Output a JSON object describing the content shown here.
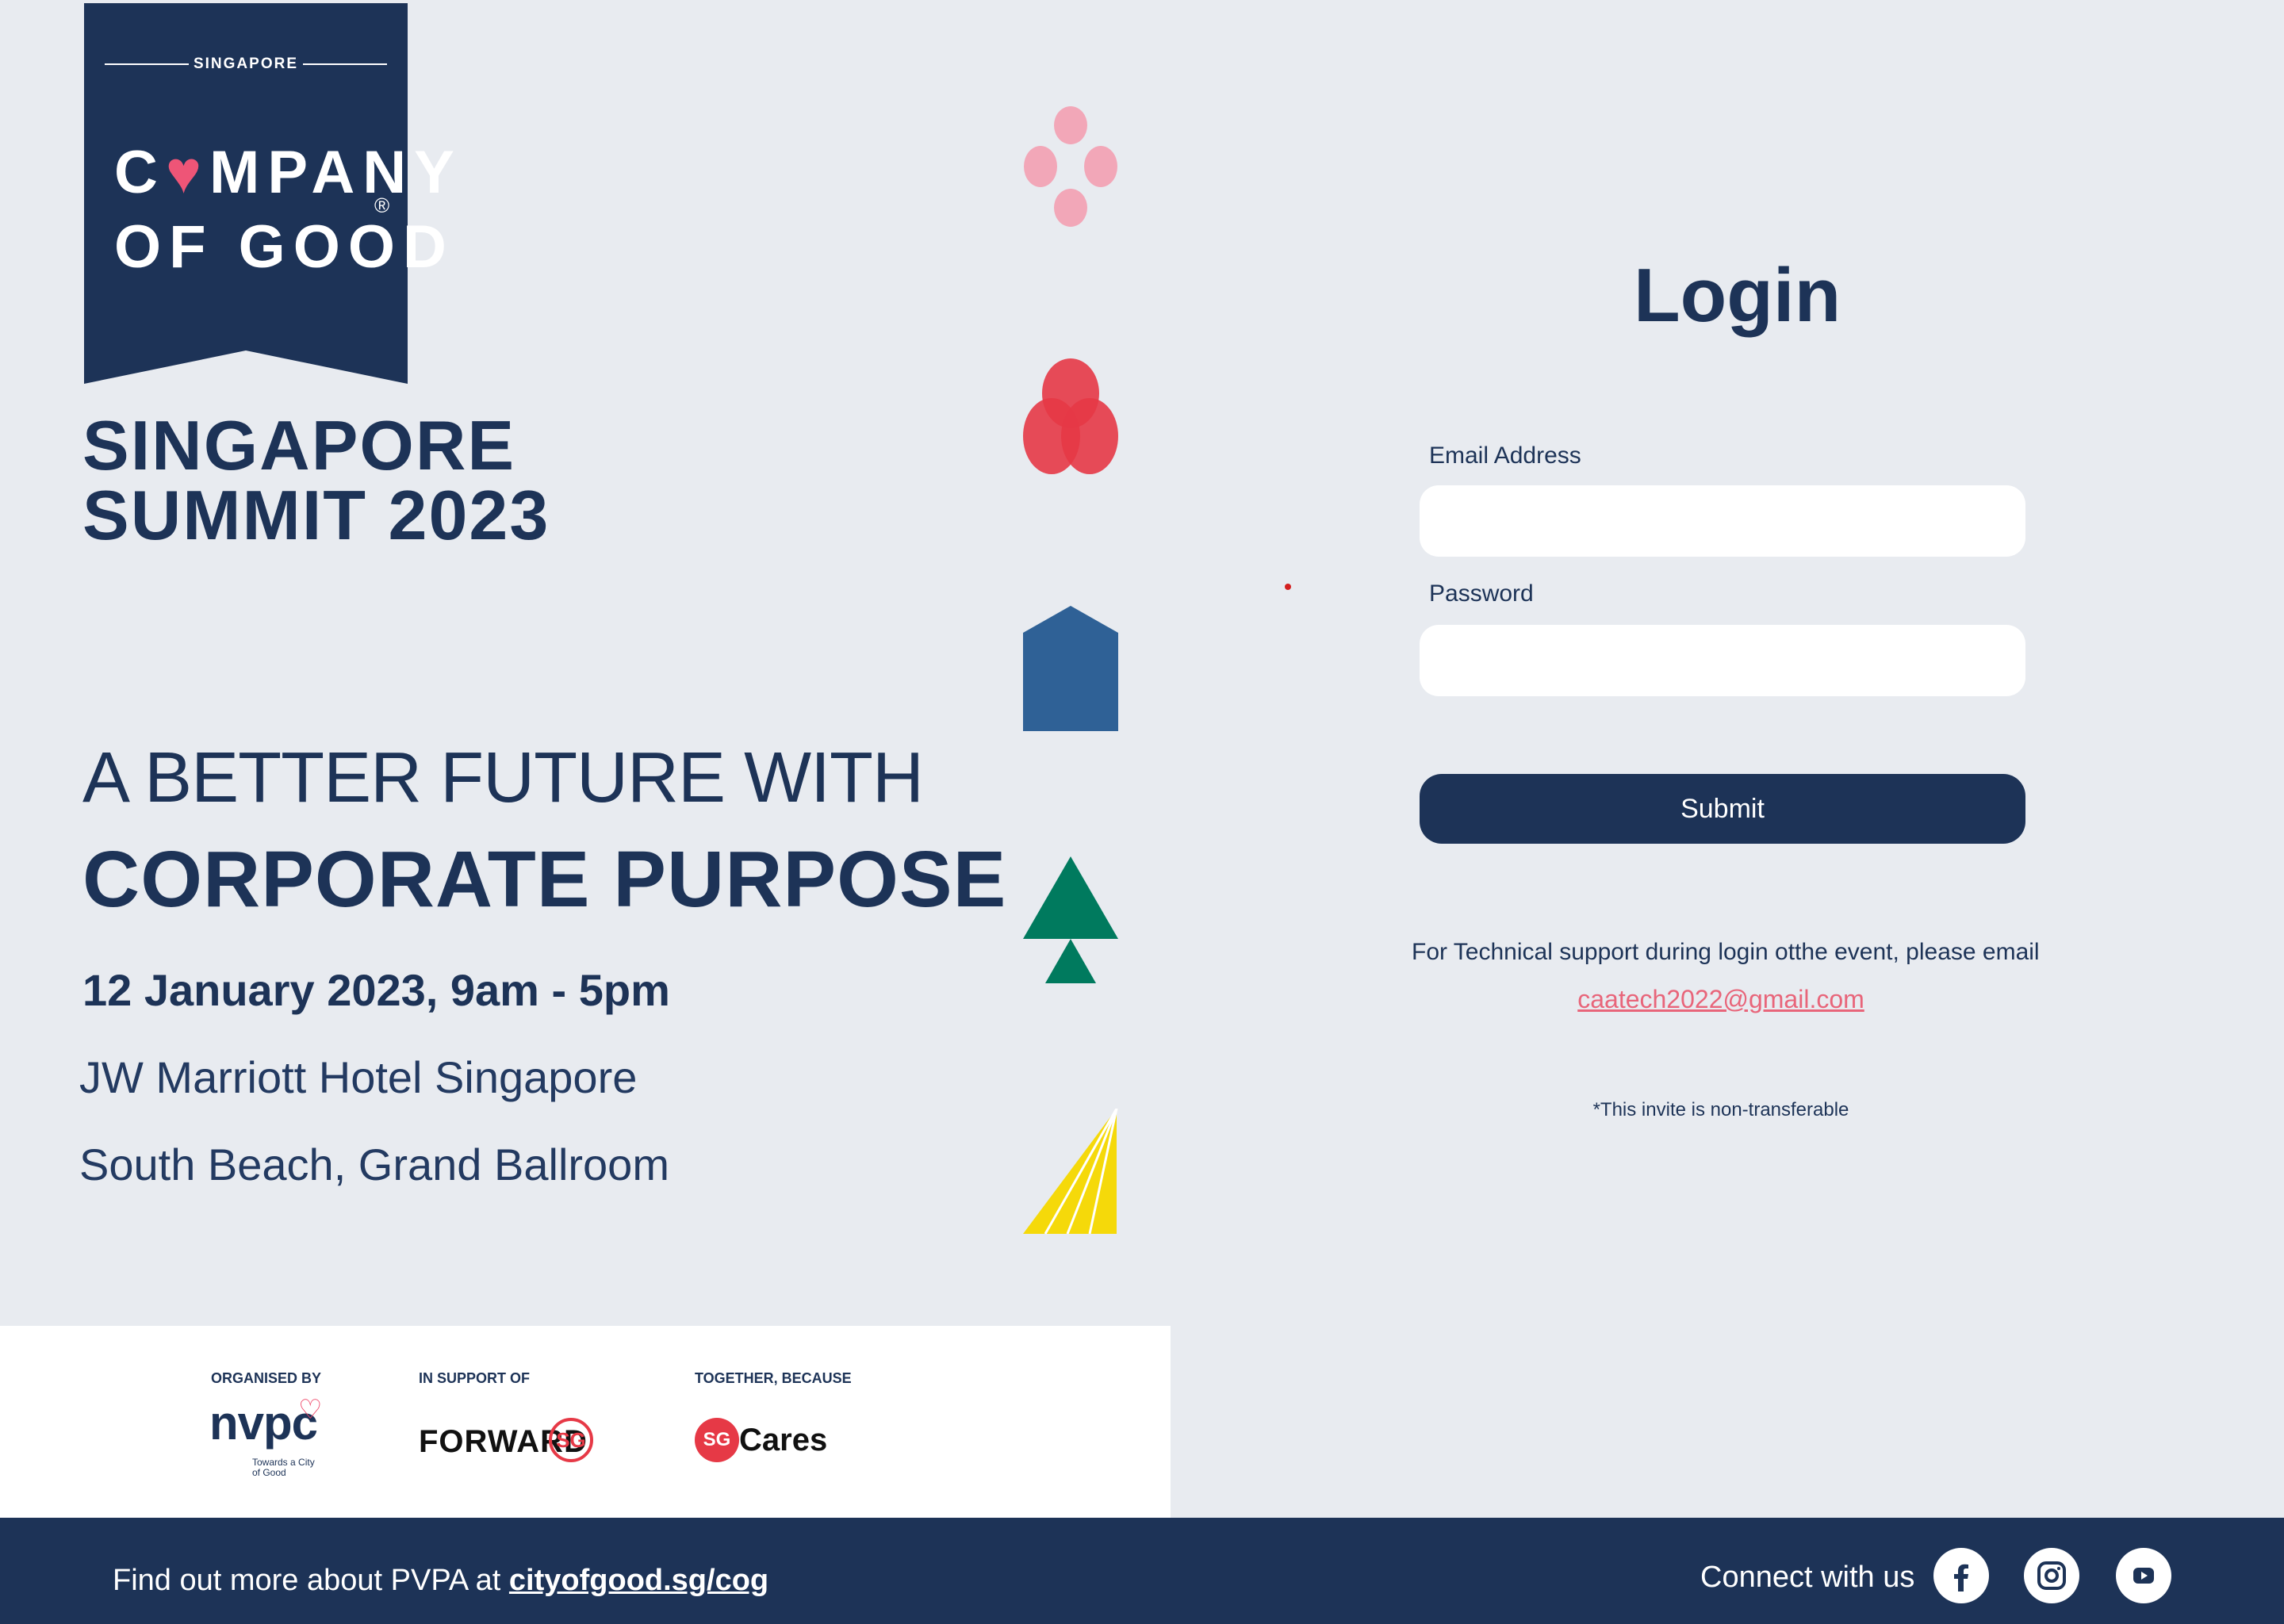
{
  "logo": {
    "kicker": "SINGAPORE",
    "word_line1_pre": "C",
    "word_line1_heart": "♥",
    "word_line1_post": "MPANY",
    "word_line2": "OF GOOD",
    "registered": "®"
  },
  "summit": {
    "line1": "SINGAPORE",
    "line2": "SUMMIT 2023"
  },
  "event": {
    "tagline_light": "A BETTER FUTURE WITH",
    "tagline_bold": "CORPORATE PURPOSE",
    "date": "12 January 2023, 9am - 5pm",
    "venue_line1": "JW Marriott Hotel Singapore",
    "venue_line2": "South Beach, Grand Ballroom"
  },
  "sponsors": {
    "organised_by_label": "ORGANISED BY",
    "organiser_name": "nvpc",
    "organiser_tagline": "Towards a City of Good",
    "in_support_of_label": "IN SUPPORT OF",
    "support_name": "FORWARD",
    "support_badge": "SG",
    "together_label": "TOGETHER, BECAUSE",
    "together_badge": "SG",
    "together_name": "Cares"
  },
  "login": {
    "title": "Login",
    "email_label": "Email Address",
    "email_value": "",
    "password_label": "Password",
    "password_value": "",
    "submit_label": "Submit",
    "support_text": "For Technical support during login otthe event, please email",
    "support_email": "caatech2022@gmail.com",
    "disclaimer": "*This invite is non-transferable"
  },
  "footer": {
    "find_out_text": "Find out more about PVPA at ",
    "find_out_link": "cityofgood.sg/cog",
    "connect_text": "Connect with us",
    "social_icons": [
      "facebook-icon",
      "instagram-icon",
      "youtube-icon"
    ]
  },
  "colors": {
    "navy": "#1d3357",
    "background": "#e8ebf0",
    "pink": "#f2a7b8",
    "red": "#e63946",
    "blue": "#2f6196",
    "green": "#007a5e",
    "yellow": "#f5d90a",
    "link_pink": "#e8657a"
  }
}
